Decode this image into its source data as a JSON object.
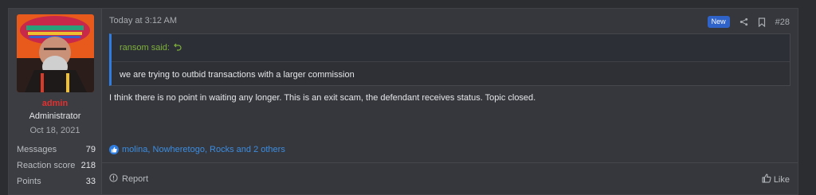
{
  "user": {
    "username": "admin",
    "title": "Administrator",
    "joined": "Oct 18, 2021",
    "stats": [
      {
        "label": "Messages",
        "value": "79"
      },
      {
        "label": "Reaction score",
        "value": "218"
      },
      {
        "label": "Points",
        "value": "33"
      }
    ]
  },
  "post": {
    "date": "Today at 3:12 AM",
    "badge": "New",
    "number": "#28",
    "quote": {
      "author_line": "ransom said:",
      "text": "we are trying to outbid transactions with a larger commission"
    },
    "message": "I think there is no point in waiting any longer. This is an exit scam, the defendant receives status. Topic closed.",
    "reactions": "molina, Nowheretogo, Rocks and 2 others",
    "report_label": "Report",
    "like_label": "Like"
  },
  "colors": {
    "accent": "#2f7de1",
    "username": "#e03131",
    "quote_author": "#7fb13b",
    "badge": "#2f63c9"
  },
  "icons": [
    "share-icon",
    "bookmark-icon",
    "reply-arrow-icon",
    "like-reaction-icon",
    "report-icon",
    "thumbs-up-icon"
  ]
}
